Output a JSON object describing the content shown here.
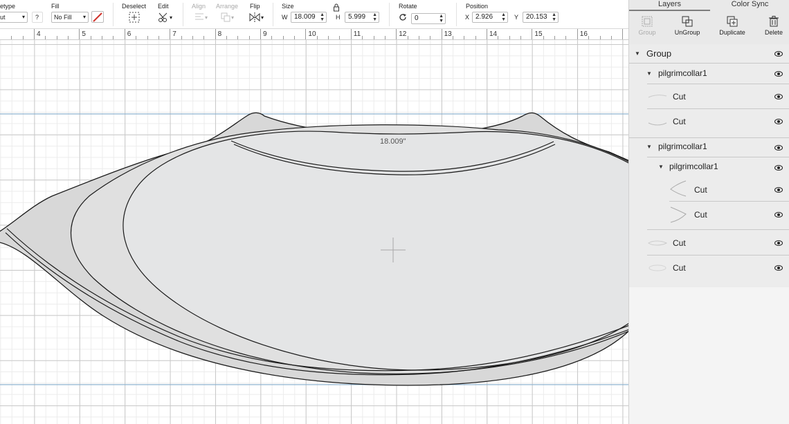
{
  "toolbar": {
    "linetype_label": "etype",
    "linetype_value": "ut",
    "linetype_help": "?",
    "fill_label": "Fill",
    "fill_value": "No Fill",
    "deselect_label": "Deselect",
    "edit_label": "Edit",
    "align_label": "Align",
    "arrange_label": "Arrange",
    "flip_label": "Flip",
    "size_label": "Size",
    "w_label": "W",
    "w_value": "18.009",
    "h_label": "H",
    "h_value": "5.999",
    "rotate_label": "Rotate",
    "rotate_value": "0",
    "position_label": "Position",
    "x_label": "X",
    "x_value": "2.926",
    "y_label": "Y",
    "y_value": "20.153"
  },
  "ruler": {
    "numbers": [
      "4",
      "5",
      "6",
      "7",
      "8",
      "9",
      "10",
      "11",
      "12",
      "13",
      "14",
      "15",
      "16"
    ]
  },
  "canvas": {
    "width_readout": "18.009\""
  },
  "panel": {
    "tabs": [
      "Layers",
      "Color Sync"
    ],
    "actions": [
      {
        "label": "Group",
        "enabled": false
      },
      {
        "label": "UnGroup",
        "enabled": true
      },
      {
        "label": "Duplicate",
        "enabled": true
      },
      {
        "label": "Delete",
        "enabled": true
      }
    ],
    "layers": [
      {
        "name": "Group",
        "level": 0,
        "expandable": true
      },
      {
        "name": "pilgrimcollar1",
        "level": 1,
        "expandable": true
      },
      {
        "name": "Cut",
        "level": 2,
        "expandable": false
      },
      {
        "name": "Cut",
        "level": 2,
        "expandable": false
      },
      {
        "name": "pilgrimcollar1",
        "level": 1,
        "expandable": true
      },
      {
        "name": "pilgrimcollar1",
        "level": 2,
        "expandable": true
      },
      {
        "name": "Cut",
        "level": 3,
        "expandable": false
      },
      {
        "name": "Cut",
        "level": 3,
        "expandable": false
      },
      {
        "name": "Cut",
        "level": 2,
        "expandable": false
      },
      {
        "name": "Cut",
        "level": 2,
        "expandable": false
      }
    ]
  },
  "colors": {
    "guide_blue": "#8fb3d1",
    "shape_fill": "#dcdcdc",
    "shape_inner": "#e3e3e3",
    "stroke": "#1a1a1a",
    "fill_swatch_red": "#d0342c"
  }
}
